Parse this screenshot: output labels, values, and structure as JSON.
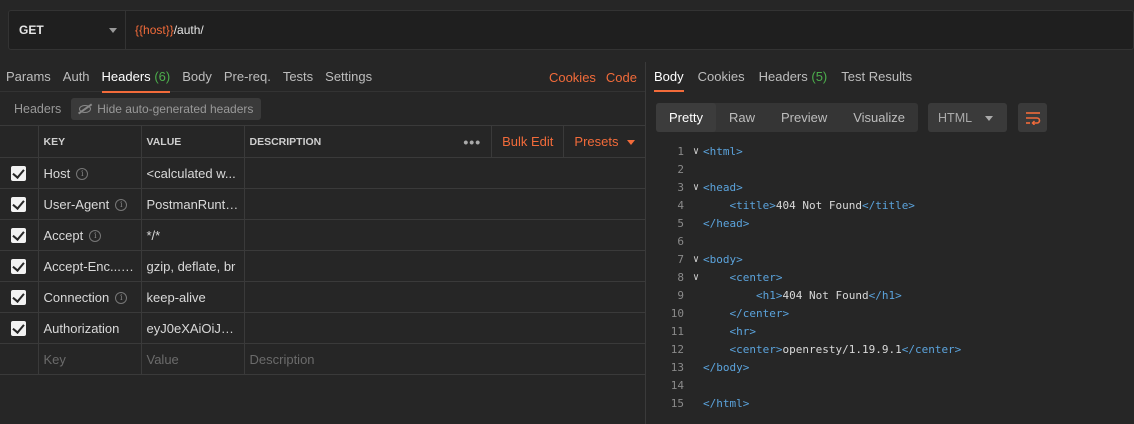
{
  "request": {
    "method": "GET",
    "url_var": "{{host}}",
    "url_path": "/auth/"
  },
  "request_tabs": [
    {
      "label": "Params"
    },
    {
      "label": "Auth"
    },
    {
      "label": "Headers",
      "count": "(6)"
    },
    {
      "label": "Body"
    },
    {
      "label": "Pre-req."
    },
    {
      "label": "Tests"
    },
    {
      "label": "Settings"
    }
  ],
  "request_links": {
    "cookies": "Cookies",
    "code": "Code"
  },
  "headers_section": {
    "title": "Headers",
    "hide_button": "Hide auto-generated headers",
    "col_key": "KEY",
    "col_value": "VALUE",
    "col_description": "DESCRIPTION",
    "more": "•••",
    "bulk_edit": "Bulk Edit",
    "presets": "Presets",
    "rows": [
      {
        "key": "Host",
        "value": "<calculated w..."
      },
      {
        "key": "User-Agent",
        "value": "PostmanRunti..."
      },
      {
        "key": "Accept",
        "value": "*/*"
      },
      {
        "key": "Accept-Enc...",
        "value": "gzip, deflate, br"
      },
      {
        "key": "Connection",
        "value": "keep-alive"
      },
      {
        "key": "Authorization",
        "value": "eyJ0eXAiOiJKV..."
      }
    ],
    "placeholder_key": "Key",
    "placeholder_value": "Value",
    "placeholder_description": "Description",
    "info_glyph": "i"
  },
  "response_tabs": [
    {
      "label": "Body"
    },
    {
      "label": "Cookies"
    },
    {
      "label": "Headers",
      "count": "(5)"
    },
    {
      "label": "Test Results"
    }
  ],
  "view_modes": [
    "Pretty",
    "Raw",
    "Preview",
    "Visualize"
  ],
  "language": "HTML",
  "code_lines": [
    {
      "n": "1",
      "fold": true,
      "parts": [
        [
          "tag",
          "<html>"
        ]
      ]
    },
    {
      "n": "2",
      "fold": false,
      "parts": []
    },
    {
      "n": "3",
      "fold": true,
      "parts": [
        [
          "tag",
          "<head>"
        ]
      ]
    },
    {
      "n": "4",
      "fold": false,
      "parts": [
        [
          "txt",
          "    "
        ],
        [
          "tag",
          "<title>"
        ],
        [
          "txt",
          "404 Not Found"
        ],
        [
          "tag",
          "</title>"
        ]
      ]
    },
    {
      "n": "5",
      "fold": false,
      "parts": [
        [
          "tag",
          "</head>"
        ]
      ]
    },
    {
      "n": "6",
      "fold": false,
      "parts": []
    },
    {
      "n": "7",
      "fold": true,
      "parts": [
        [
          "tag",
          "<body>"
        ]
      ]
    },
    {
      "n": "8",
      "fold": true,
      "parts": [
        [
          "txt",
          "    "
        ],
        [
          "tag",
          "<center>"
        ]
      ]
    },
    {
      "n": "9",
      "fold": false,
      "parts": [
        [
          "txt",
          "        "
        ],
        [
          "tag",
          "<h1>"
        ],
        [
          "txt",
          "404 Not Found"
        ],
        [
          "tag",
          "</h1>"
        ]
      ]
    },
    {
      "n": "10",
      "fold": false,
      "parts": [
        [
          "txt",
          "    "
        ],
        [
          "tag",
          "</center>"
        ]
      ]
    },
    {
      "n": "11",
      "fold": false,
      "parts": [
        [
          "txt",
          "    "
        ],
        [
          "tag",
          "<hr>"
        ]
      ]
    },
    {
      "n": "12",
      "fold": false,
      "parts": [
        [
          "txt",
          "    "
        ],
        [
          "tag",
          "<center>"
        ],
        [
          "txt",
          "openresty/1.19.9.1"
        ],
        [
          "tag",
          "</center>"
        ]
      ]
    },
    {
      "n": "13",
      "fold": false,
      "parts": [
        [
          "tag",
          "</body>"
        ]
      ]
    },
    {
      "n": "14",
      "fold": false,
      "parts": []
    },
    {
      "n": "15",
      "fold": false,
      "parts": [
        [
          "tag",
          "</html>"
        ]
      ]
    }
  ],
  "colors": {
    "accent": "#f26b3a",
    "count_green": "#4cae4c",
    "tag_blue": "#5ba3dc"
  }
}
